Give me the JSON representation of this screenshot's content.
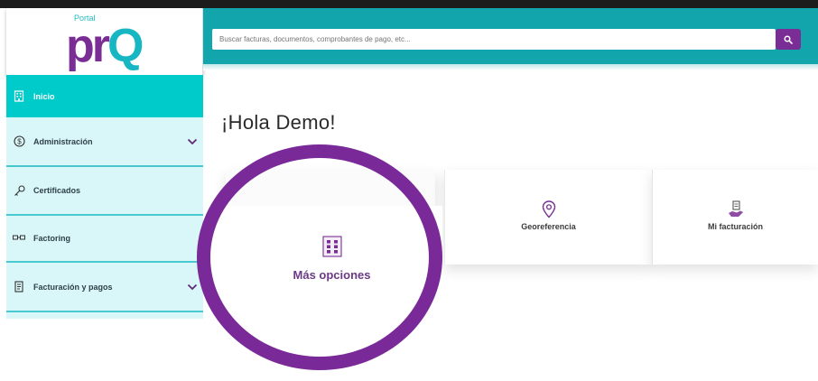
{
  "logo": {
    "small": "Portal",
    "main_a": "pr",
    "main_b": "Q"
  },
  "search": {
    "placeholder": "Buscar facturas, documentos, comprobantes de pago, etc..."
  },
  "sidebar": {
    "items": [
      {
        "label": "Inicio",
        "icon": "building-icon",
        "active": true
      },
      {
        "label": "Administración",
        "icon": "dollar-circle-icon",
        "expandable": true
      },
      {
        "label": "Certificados",
        "icon": "key-icon"
      },
      {
        "label": "Factoring",
        "icon": "factoring-icon"
      },
      {
        "label": "Facturación y pagos",
        "icon": "invoice-icon",
        "expandable": true
      }
    ]
  },
  "main": {
    "greeting": "¡Hola Demo!",
    "cards": [
      {
        "label": "Georeferencia",
        "icon": "location-pin-icon"
      },
      {
        "label": "Mi facturación",
        "icon": "billing-hand-icon"
      },
      {
        "label": "Más opciones",
        "icon": "grid-options-icon"
      }
    ]
  },
  "colors": {
    "brand_purple": "#7a2d95",
    "brand_teal": "#12a5ab",
    "sidebar_active": "#00cbcb",
    "sidebar_bg": "#d9f7f8",
    "highlight_circle": "#7a2998"
  }
}
